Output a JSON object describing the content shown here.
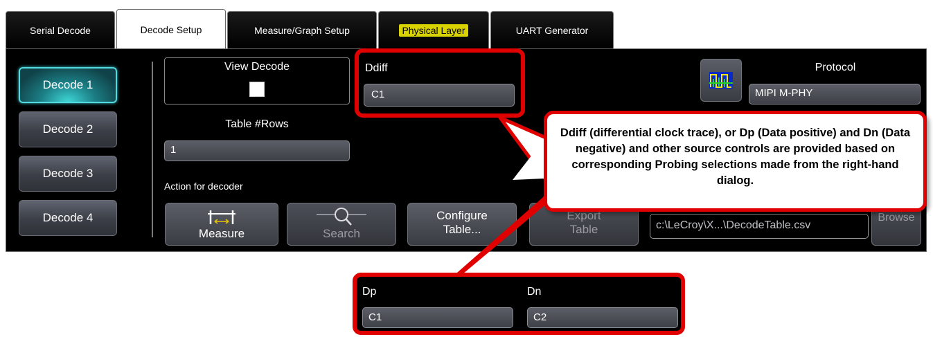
{
  "tabs": [
    {
      "label": "Serial Decode",
      "active": false
    },
    {
      "label": "Decode Setup",
      "active": true
    },
    {
      "label": "Measure/Graph Setup",
      "active": false
    },
    {
      "label": "Physical Layer",
      "active": false,
      "highlight": "#d7d200"
    },
    {
      "label": "UART Generator",
      "active": false
    }
  ],
  "decoders": [
    {
      "label": "Decode 1",
      "active": true
    },
    {
      "label": "Decode 2",
      "active": false
    },
    {
      "label": "Decode 3",
      "active": false
    },
    {
      "label": "Decode 4",
      "active": false
    }
  ],
  "view_decode": {
    "label": "View Decode",
    "checked": false
  },
  "table_rows": {
    "label": "Table #Rows",
    "value": "1"
  },
  "action_label": "Action for decoder",
  "actions": {
    "measure": "Measure",
    "search": "Search",
    "configure_line1": "Configure",
    "configure_line2": "Table...",
    "export_line1": "Export",
    "export_line2": "Table",
    "browse": "Browse"
  },
  "file_path": "c:\\LeCroy\\X...\\DecodeTable.csv",
  "ddiff": {
    "label": "Ddiff",
    "value": "C1"
  },
  "protocol": {
    "label": "Protocol",
    "value": "MIPI M-PHY",
    "icon": "protocol-waveform-icon"
  },
  "callout_text": "Ddiff (differential clock trace), or Dp (Data positive) and Dn (Data negative) and other source controls are provided based on corresponding Probing selections made from the right-hand dialog.",
  "popup": {
    "dp": {
      "label": "Dp",
      "value": "C1"
    },
    "dn": {
      "label": "Dn",
      "value": "C2"
    }
  },
  "colors": {
    "accent": "#53d9e0",
    "callout_border": "#e00000",
    "highlight": "#d7d200"
  }
}
